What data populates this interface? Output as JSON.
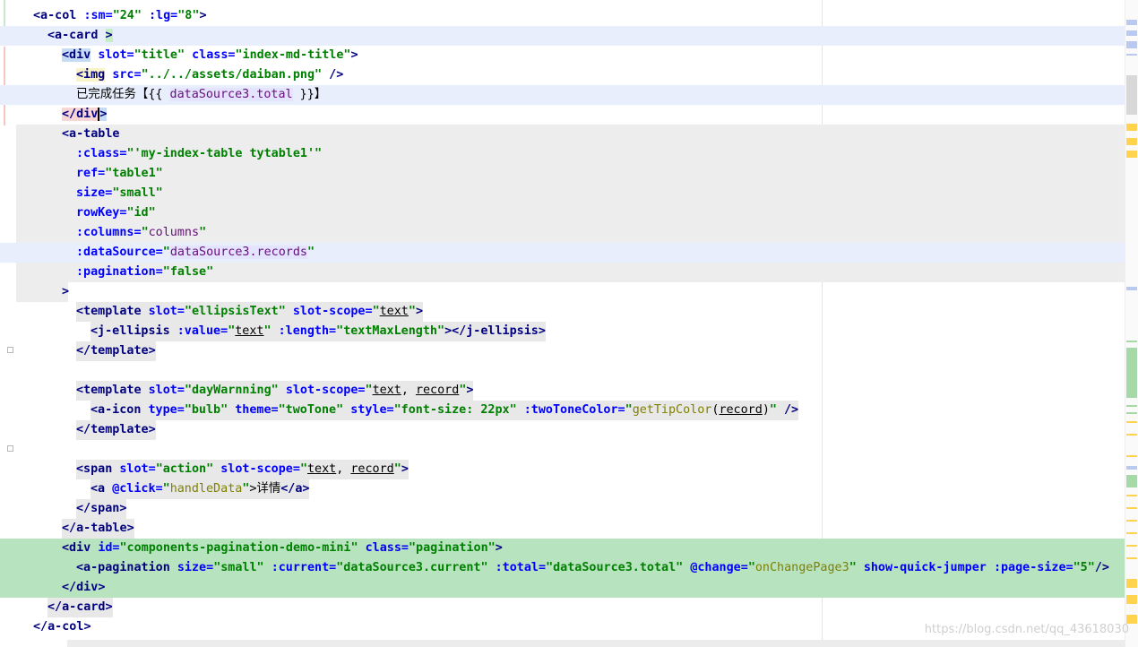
{
  "editor": {
    "lines": {
      "l1": [
        "<a-col",
        ":sm=",
        "\"24\"",
        ":lg=",
        "\"8\"",
        ">"
      ],
      "l2": [
        "<a-card",
        ">"
      ],
      "l3": [
        "<div",
        "slot=",
        "\"title\"",
        "class=",
        "\"index-md-title\"",
        ">"
      ],
      "l4": [
        "<img",
        "src=",
        "\"../../assets/daiban.png\"",
        "/>"
      ],
      "l5": [
        "已完成任务【{{",
        "dataSource3.total",
        "}}】"
      ],
      "l6": [
        "</div",
        ">"
      ],
      "l7": [
        "<a-table"
      ],
      "l8": [
        ":class=",
        "\"'my-index-table tytable1'\""
      ],
      "l9": [
        "ref=",
        "\"table1\""
      ],
      "l10": [
        "size=",
        "\"small\""
      ],
      "l11": [
        "rowKey=",
        "\"id\""
      ],
      "l12": [
        ":columns=",
        "\"",
        "columns",
        "\""
      ],
      "l13": [
        ":dataSource=",
        "\"",
        "dataSource3.records",
        "\""
      ],
      "l14": [
        ":pagination=",
        "\"",
        "false",
        "\""
      ],
      "l15": [
        ">"
      ],
      "l16": [
        "<template",
        "slot=",
        "\"ellipsisText\"",
        "slot-scope=",
        "\"",
        "text",
        "\"",
        ">"
      ],
      "l17": [
        "<j-ellipsis",
        ":value=",
        "\"",
        "text",
        "\"",
        ":length=",
        "\"",
        "textMaxLength",
        "\"",
        "></j-ellipsis",
        ">"
      ],
      "l18": [
        "</template",
        ">"
      ],
      "l19": [
        "<template",
        "slot=",
        "\"dayWarnning\"",
        "slot-scope=",
        "\"",
        "text",
        ", ",
        "record",
        "\"",
        ">"
      ],
      "l20": [
        "<a-icon",
        "type=",
        "\"bulb\"",
        "theme=",
        "\"twoTone\"",
        "style=",
        "\"font-size: 22px\"",
        ":twoToneColor=",
        "\"",
        "getTipColor",
        "(",
        "record",
        ")",
        "\"",
        "/>"
      ],
      "l21": [
        "</template",
        ">"
      ],
      "l22": [
        "<span",
        "slot=",
        "\"action\"",
        "slot-scope=",
        "\"",
        "text",
        ", ",
        "record",
        "\"",
        ">"
      ],
      "l23": [
        "<a",
        "@click=",
        "\"",
        "handleData",
        "\"",
        ">详情",
        "</a",
        ">"
      ],
      "l24": [
        "</span",
        ">"
      ],
      "l25": [
        "</a-table",
        ">"
      ],
      "l26": [
        "<div",
        "id=",
        "\"components-pagination-demo-mini\"",
        "class=",
        "\"pagination\"",
        ">"
      ],
      "l27": [
        "<a-pagination",
        "size=",
        "\"small\"",
        ":current=",
        "\"dataSource3.current\"",
        ":total=",
        "\"dataSource3.total\"",
        "@change=",
        "\"",
        "onChangePage3",
        "\"",
        "show-quick-jumper",
        ":page-size=",
        "\"5\"",
        "/>"
      ],
      "l28": [
        "</div",
        ">"
      ],
      "l29": [
        "</a-card",
        ">"
      ],
      "l30": [
        "</a-col",
        ">"
      ]
    }
  },
  "watermark": "https://blog.csdn.net/qq_43618030",
  "colors": {
    "tag": "#000080",
    "attribute": "#0000ff",
    "string": "#008000",
    "expression": "#660e7a",
    "function": "#808000",
    "highlight_blue": "#e9eefc",
    "highlight_gray": "#ededed",
    "highlight_green": "#b8e3bf"
  }
}
